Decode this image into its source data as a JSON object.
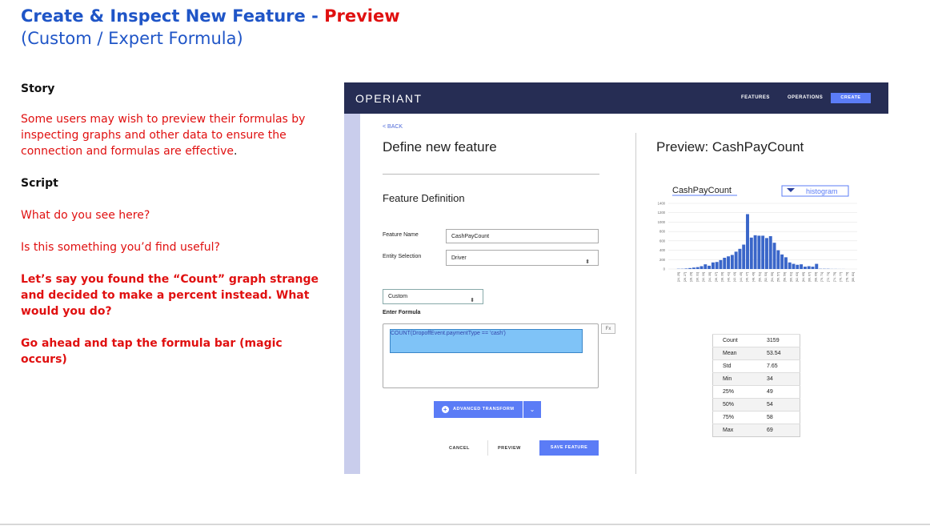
{
  "slide": {
    "title_main": "Create & Inspect New Feature - ",
    "title_highlight": "Preview",
    "subtitle": "(Custom / Expert Formula)",
    "story_label": "Story",
    "story_text": "Some users may wish to preview their formulas by inspecting graphs and other data to ensure the connection and formulas are effective",
    "story_end": ".",
    "script_label": "Script",
    "q1": "What do you see here?",
    "q2": "Is this something you’d find useful?",
    "q3": "Let’s say you found the “Count” graph strange and decided to make a percent instead. What would you do?",
    "q4": "Go ahead and tap the formula bar (magic occurs)"
  },
  "app": {
    "logo": "OPERIANT",
    "nav": [
      "FEATURES",
      "OPERATIONS",
      "CREATE"
    ],
    "back": "< BACK",
    "define_title": "Define new feature",
    "feature_def_title": "Feature Definition",
    "feature_name_label": "Feature Name",
    "feature_name_value": "CashPayCount",
    "entity_label": "Entity Selection",
    "entity_value": "Driver",
    "mode_value": "Custom",
    "enter_formula_label": "Enter Formula",
    "formula": "COUNT(DropoffEvent.paymentType == 'cash')",
    "fx": "Fx",
    "advanced_transform": "ADVANCED TRANSFORM",
    "cancel": "CANCEL",
    "preview": "PREVIEW",
    "save": "SAVE FEATURE",
    "preview_title": "Preview: CashPayCount",
    "chart_select": "histogram",
    "accent_color": "#5b7cf6",
    "nav_color": "#262d54",
    "bar_color": "#3a66c9"
  },
  "chart_data": {
    "type": "bar",
    "title": "CashPayCount",
    "ylim": [
      0,
      1400
    ],
    "yticks": [
      0,
      200,
      400,
      600,
      800,
      1000,
      1200,
      1400
    ],
    "categories": [
      "[24, 25]",
      "[26, 27]",
      "[28, 29]",
      "[30, 31]",
      "[32, 33]",
      "[34, 35]",
      "[36, 37]",
      "[38, 39]",
      "[40, 41]",
      "[42, 43]",
      "[44, 45]",
      "[46, 47]",
      "[48, 49]",
      "[50, 51]",
      "[52, 53]",
      "[54, 55]",
      "[56, 57]",
      "[58, 59]",
      "[60, 61]",
      "[62, 63]",
      "[64, 65]",
      "[66, 67]",
      "[68, 69]",
      "[70, 71]",
      "[72, 73]",
      "[74, 75]",
      "[76, 77]",
      "[78, 79]",
      "[80, 81]"
    ],
    "values": [
      0,
      5,
      5,
      10,
      20,
      30,
      40,
      60,
      100,
      70,
      140,
      150,
      190,
      240,
      270,
      300,
      370,
      430,
      520,
      1170,
      670,
      720,
      710,
      710,
      660,
      700,
      560,
      400,
      310,
      250,
      140,
      110,
      90,
      100,
      50,
      60,
      50,
      110,
      5,
      5,
      5,
      2,
      2,
      1,
      1,
      0,
      0,
      0
    ],
    "legend": "none"
  },
  "stats": [
    {
      "k": "Count",
      "v": "3159"
    },
    {
      "k": "Mean",
      "v": "53.54"
    },
    {
      "k": "Std",
      "v": "7.65"
    },
    {
      "k": "Min",
      "v": "34"
    },
    {
      "k": "25%",
      "v": "49"
    },
    {
      "k": "50%",
      "v": "54"
    },
    {
      "k": "75%",
      "v": "58"
    },
    {
      "k": "Max",
      "v": "69"
    }
  ]
}
